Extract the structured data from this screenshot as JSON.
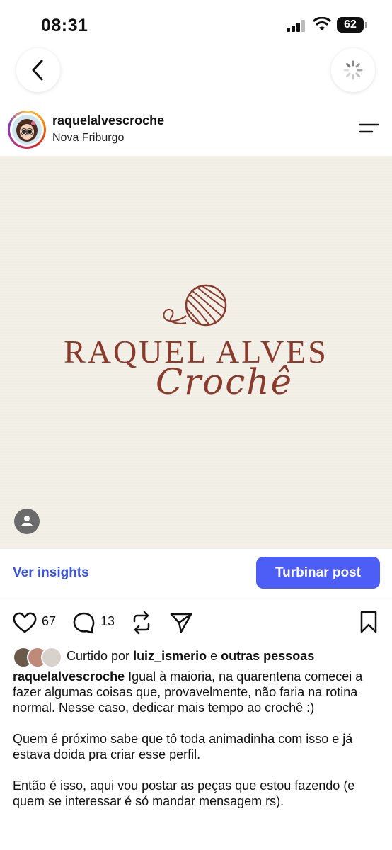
{
  "status_bar": {
    "time": "08:31",
    "battery": "62"
  },
  "post_header": {
    "username": "raquelalvescroche",
    "location": "Nova Friburgo"
  },
  "post_image": {
    "title": "RAQUEL ALVES",
    "subtitle": "Crochê"
  },
  "actions": {
    "insights_label": "Ver insights",
    "boost_label": "Turbinar post"
  },
  "engagement": {
    "likes": "67",
    "comments": "13"
  },
  "liked_by": {
    "prefix": "Curtido por",
    "user": "luiz_ismerio",
    "joiner": "e",
    "others": "outras pessoas"
  },
  "caption": {
    "username": "raquelalvescroche",
    "text1": "Igual à maioria, na quarentena comecei a fazer algumas coisas que, provavelmente, não faria na rotina normal. Nesse caso, dedicar mais tempo ao crochê :)",
    "text2": "Quem é próximo sabe que tô toda animadinha com isso e já estava doida pra criar esse perfil.",
    "text3": "Então é isso, aqui vou postar as peças que estou fazendo (e quem se interessar é só mandar mensagem rs)."
  },
  "colors": {
    "accent": "#4d5ef7",
    "link": "#3a55d9",
    "brand": "#8a3b2e"
  },
  "icons": [
    "back-icon",
    "loading-icon",
    "menu-icon",
    "heart-icon",
    "comment-icon",
    "repost-icon",
    "share-icon",
    "bookmark-icon",
    "person-tag-icon"
  ]
}
